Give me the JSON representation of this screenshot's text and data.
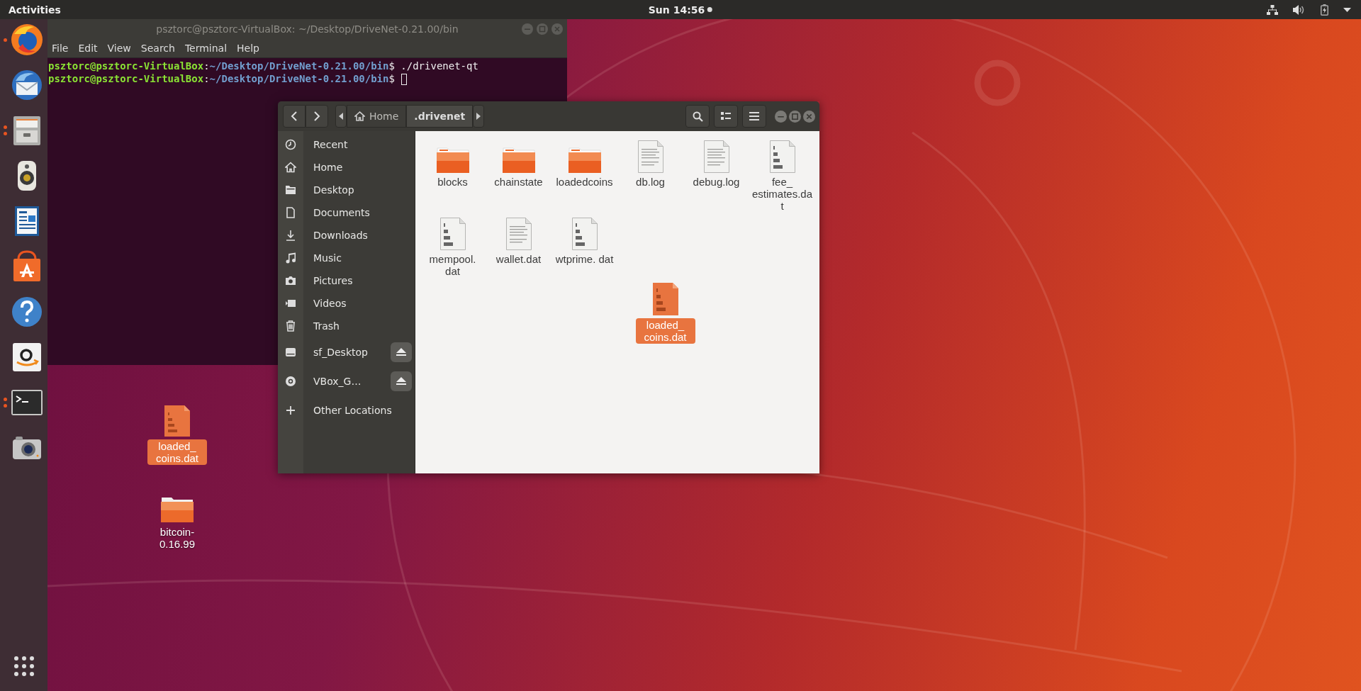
{
  "top_bar": {
    "activities": "Activities",
    "clock": "Sun 14:56",
    "notification": true
  },
  "dock": {
    "apps": [
      {
        "kind": "browser",
        "running": true,
        "several_windows": false
      },
      {
        "kind": "mail",
        "running": false,
        "several_windows": false
      },
      {
        "kind": "files",
        "running": true,
        "several_windows": true
      },
      {
        "kind": "music",
        "running": false,
        "several_windows": false
      },
      {
        "kind": "writer",
        "running": false,
        "several_windows": false
      },
      {
        "kind": "store",
        "running": false,
        "several_windows": false
      },
      {
        "kind": "help",
        "running": false,
        "several_windows": false
      },
      {
        "kind": "amazon",
        "running": false,
        "several_windows": false
      },
      {
        "kind": "terminal",
        "running": true,
        "several_windows": true
      },
      {
        "kind": "camera",
        "running": false,
        "several_windows": false
      }
    ]
  },
  "desktop": {
    "icons": [
      {
        "kind": "binary",
        "label": "loaded_ coins.dat",
        "selected": true
      },
      {
        "kind": "folder",
        "label": "bitcoin-0.16.99",
        "selected": false
      }
    ]
  },
  "terminal": {
    "title": "psztorc@psztorc-VirtualBox: ~/Desktop/DriveNet-0.21.00/bin",
    "menu": [
      "File",
      "Edit",
      "View",
      "Search",
      "Terminal",
      "Help"
    ],
    "lines": [
      {
        "user": "psztorc@psztorc-VirtualBox",
        "sep": ":",
        "path": "~/Desktop/DriveNet-0.21.00/bin",
        "prompt": "$ ",
        "command": "./drivenet-qt",
        "cursor": false
      },
      {
        "user": "psztorc@psztorc-VirtualBox",
        "sep": ":",
        "path": "~/Desktop/DriveNet-0.21.00/bin",
        "prompt": "$ ",
        "cursor": true
      }
    ]
  },
  "files": {
    "breadcrumb": [
      {
        "label": "Home",
        "home": true,
        "selected": false
      },
      {
        "label": ".drivenet",
        "home": false,
        "selected": true
      }
    ],
    "sidebar": [
      {
        "kind": "clock",
        "label": "Recent",
        "eject": false
      },
      {
        "kind": "home",
        "label": "Home",
        "eject": false
      },
      {
        "kind": "folder",
        "label": "Desktop",
        "eject": false
      },
      {
        "kind": "document",
        "label": "Documents",
        "eject": false
      },
      {
        "kind": "download",
        "label": "Downloads",
        "eject": false
      },
      {
        "kind": "music",
        "label": "Music",
        "eject": false
      },
      {
        "kind": "camera",
        "label": "Pictures",
        "eject": false
      },
      {
        "kind": "video",
        "label": "Videos",
        "eject": false
      },
      {
        "kind": "trash",
        "label": "Trash",
        "eject": false
      },
      {
        "kind": "drive",
        "label": "sf_Desktop",
        "eject": true
      },
      {
        "kind": "disc",
        "label": "VBox_G…",
        "eject": true
      },
      {
        "kind": "plus",
        "label": "Other Locations",
        "eject": false
      }
    ],
    "items": [
      {
        "kind": "folder",
        "label": "blocks",
        "selected": false
      },
      {
        "kind": "folder",
        "label": "chainstate",
        "selected": false
      },
      {
        "kind": "folder",
        "label": "loadedcoins",
        "selected": false
      },
      {
        "kind": "text",
        "label": "db.log",
        "selected": false
      },
      {
        "kind": "text",
        "label": "debug.log",
        "selected": false
      },
      {
        "kind": "binary",
        "label": "fee_ estimates.dat",
        "selected": false
      },
      {
        "kind": "binary",
        "label": "mempool. dat",
        "selected": false
      },
      {
        "kind": "text",
        "label": "wallet.dat",
        "selected": false
      },
      {
        "kind": "binary",
        "label": "wtprime. dat",
        "selected": false
      },
      {
        "kind": "binary",
        "label": "loaded_ coins.dat",
        "selected": true
      }
    ]
  }
}
